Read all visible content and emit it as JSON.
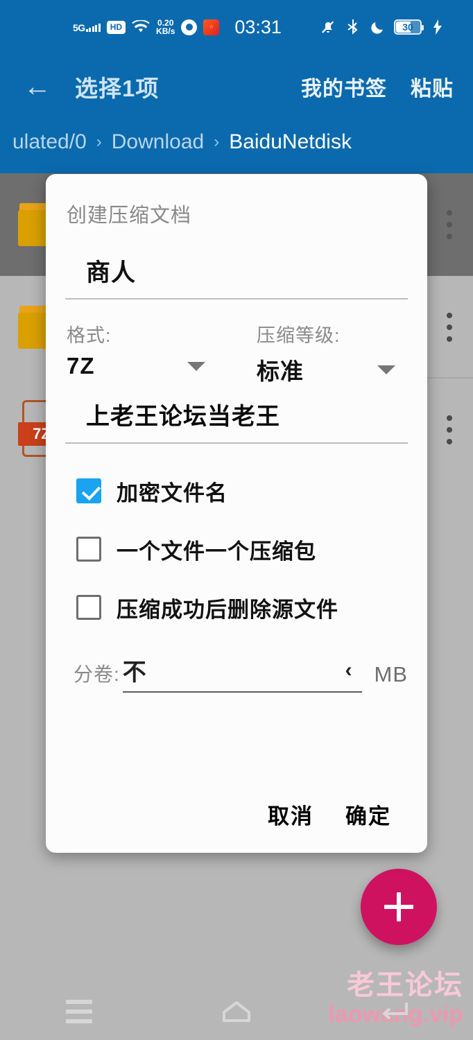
{
  "status_bar": {
    "network_type": "5G",
    "volte": "HD",
    "net_speed_value": "0.20",
    "net_speed_unit": "KB/s",
    "chrome_icon": "chrome-icon",
    "app_icon": "app-icon",
    "wifi_icon": "wifi-icon",
    "time": "03:31",
    "mute_icon": "mute-bell-icon",
    "bluetooth_icon": "bluetooth-icon",
    "dnd_icon": "moon-icon",
    "battery_level": "30",
    "charging_icon": "bolt-icon"
  },
  "app_bar": {
    "back_icon": "back-arrow-icon",
    "title": "选择1项",
    "actions": [
      "我的书签",
      "粘贴"
    ],
    "breadcrumb": [
      "ulated/0",
      "Download",
      "BaiduNetdisk"
    ],
    "breadcrumb_separator": "›",
    "background_color": "#0b6aae"
  },
  "file_list": {
    "rows": [
      {
        "icon": "folder-icon",
        "selected": true
      },
      {
        "icon": "folder-icon",
        "selected": false
      },
      {
        "icon": "archive-7z-icon",
        "selected": false
      }
    ],
    "overflow_icon": "more-vertical-icon"
  },
  "dialog": {
    "title": "创建压缩文档",
    "filename": {
      "value": "商人",
      "name": "archive-name-input"
    },
    "format": {
      "label": "格式:",
      "value": "7Z",
      "caret": "chevron-down-icon"
    },
    "level": {
      "label": "压缩等级:",
      "value": "标准",
      "caret": "chevron-down-icon"
    },
    "password": {
      "value": "上老王论坛当老王",
      "name": "password-input"
    },
    "checkboxes": [
      {
        "label": "加密文件名",
        "checked": true
      },
      {
        "label": "一个文件一个压缩包",
        "checked": false
      },
      {
        "label": "压缩成功后删除源文件",
        "checked": false
      }
    ],
    "split": {
      "label": "分卷:",
      "value": "不",
      "chevron": "‹",
      "unit": "MB"
    },
    "buttons": {
      "cancel": "取消",
      "ok": "确定"
    },
    "accent_color": "#1aa3f0"
  },
  "fab": {
    "icon": "plus-icon",
    "color": "#cf1260"
  },
  "watermark": {
    "line1": "老王论坛",
    "line2": "laowang.vip"
  },
  "nav_bar": {
    "recents_icon": "menu-icon",
    "home_icon": "home-icon",
    "back_icon": "back-icon"
  }
}
